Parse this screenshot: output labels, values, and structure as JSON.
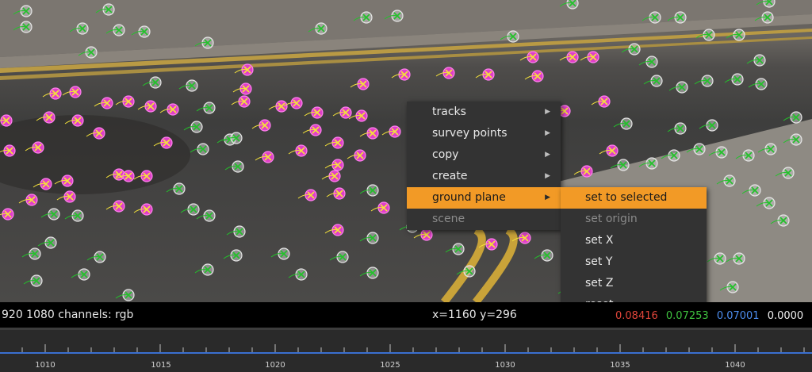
{
  "viewer": {
    "info": {
      "format": "920 1080 channels: rgb",
      "coords": "x=1160 y=296",
      "pixel": {
        "r": "0.08416",
        "g": "0.07253",
        "b": "0.07001",
        "a": "0.0000"
      }
    }
  },
  "context_menu": {
    "items": [
      {
        "label": "tracks",
        "submenu": true
      },
      {
        "label": "survey points",
        "submenu": true
      },
      {
        "label": "copy",
        "submenu": true
      },
      {
        "label": "create",
        "submenu": true
      },
      {
        "label": "ground plane",
        "submenu": true,
        "highlighted": true
      },
      {
        "label": "scene",
        "disabled": true
      }
    ],
    "submenu": {
      "items": [
        {
          "label": "set to selected",
          "highlighted": true
        },
        {
          "label": "set origin",
          "disabled": true
        },
        {
          "label": "set X"
        },
        {
          "label": "set Y"
        },
        {
          "label": "set Z"
        },
        {
          "label": "reset"
        }
      ]
    }
  },
  "timeline": {
    "frame_labels": [
      "1010",
      "1015",
      "1020",
      "1025",
      "1030",
      "1035",
      "1040"
    ]
  },
  "colors": {
    "highlight": "#f29a26",
    "menu_bg": "#333333",
    "track_selected": "#e040c8",
    "track_green": "#2ecc40",
    "playhead_line": "#3a6fd0"
  }
}
